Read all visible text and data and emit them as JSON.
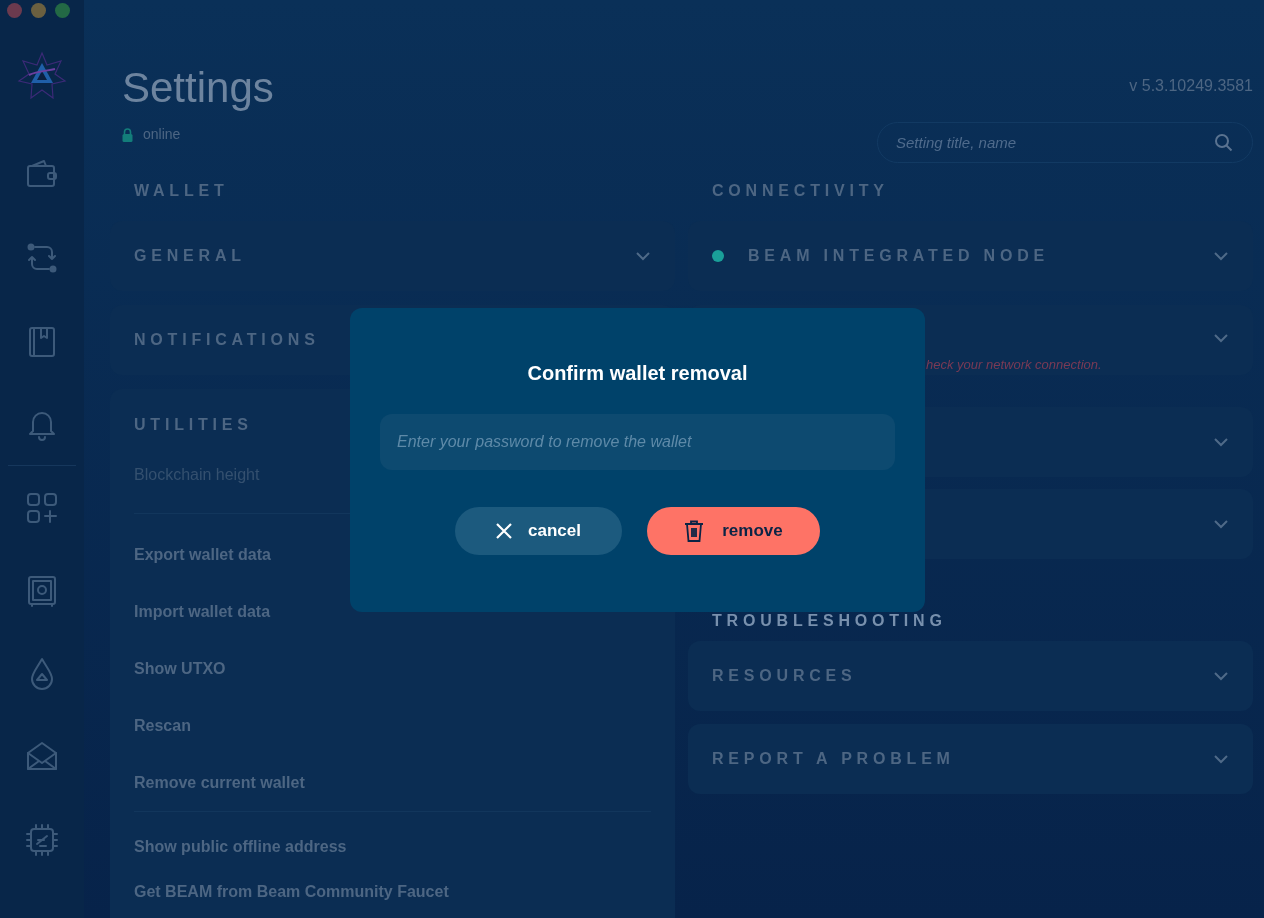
{
  "header": {
    "title": "Settings",
    "status": "online",
    "version": "v 5.3.10249.3581",
    "search": {
      "placeholder": "Setting title, name"
    }
  },
  "wallet": {
    "heading": "WALLET",
    "sections": [
      {
        "kind": "collapsible",
        "title": "GENERAL"
      },
      {
        "kind": "partly_covered",
        "title": "NOTIFICATIONS"
      }
    ],
    "utilities": {
      "title": "UTILITIES",
      "groups": [
        [
          {
            "kind": "info",
            "label": "Blockchain height"
          }
        ],
        [
          {
            "kind": "action",
            "label": "Export wallet data"
          },
          {
            "kind": "action",
            "label": "Import wallet data"
          },
          {
            "kind": "action",
            "label": "Show UTXO"
          },
          {
            "kind": "action",
            "label": "Rescan"
          },
          {
            "kind": "action",
            "label": "Remove current wallet"
          }
        ],
        [
          {
            "kind": "action",
            "label": "Show public offline address"
          },
          {
            "kind": "action",
            "label": "Get BEAM from Beam Community Faucet"
          }
        ]
      ]
    }
  },
  "connectivity": {
    "heading": "CONNECTIVITY",
    "sections": [
      {
        "kind": "status",
        "title": "BEAM INTEGRATED NODE",
        "color": "#1a9f99"
      },
      {
        "kind": "error",
        "message": "heck your network connection."
      },
      {
        "kind": "plain"
      },
      {
        "kind": "plain"
      }
    ]
  },
  "troubleshooting": {
    "heading": "TROUBLESHOOTING",
    "sections": [
      {
        "title": "RESOURCES"
      },
      {
        "title": "REPORT A PROBLEM"
      }
    ]
  },
  "dialog": {
    "title": "Confirm wallet removal",
    "placeholder": "Enter your password to remove the wallet",
    "buttons": [
      {
        "kind": "cancel",
        "label": "cancel"
      },
      {
        "kind": "danger",
        "label": "remove"
      }
    ]
  }
}
